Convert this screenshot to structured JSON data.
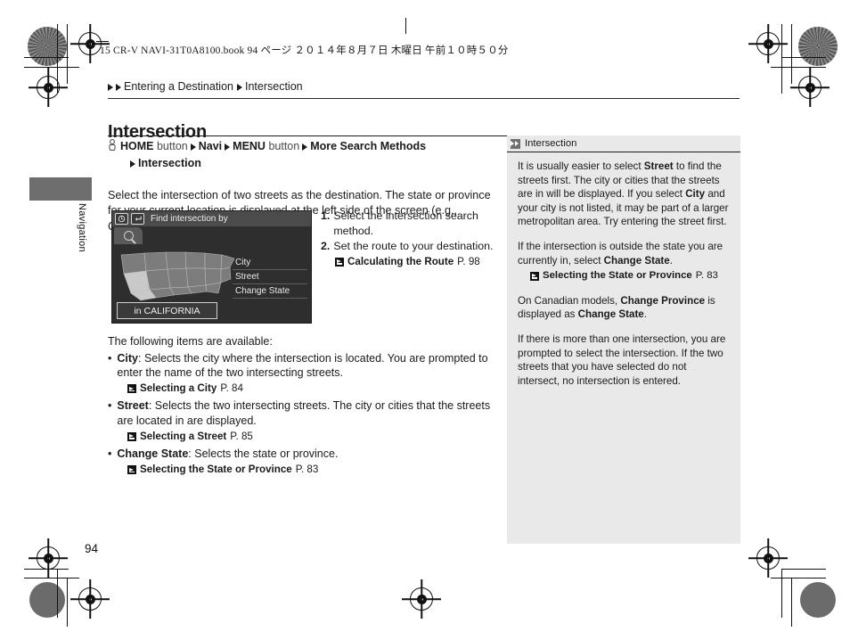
{
  "print_header": {
    "text": "15 CR-V NAVI-31T0A8100.book   94 ページ   ２０１４年８月７日   木曜日   午前１０時５０分"
  },
  "breadcrumb": {
    "item1": "Entering a Destination",
    "item2": "Intersection"
  },
  "side_tab": {
    "label": "Navigation"
  },
  "page": {
    "title": "Intersection",
    "folio": "94"
  },
  "navpath": {
    "hand_icon": "hand-pointer-icon",
    "home": "HOME",
    "home_suffix": "button",
    "navi": "Navi",
    "menu": "MENU",
    "menu_suffix": "button",
    "more_search": "More Search Methods",
    "intersection": "Intersection"
  },
  "intro": {
    "text": "Select the intersection of two streets as the destination. The state or province for your current location is displayed at the left side of the screen (e.g., CALIFORNIA)."
  },
  "device_screenshot": {
    "title": "Find intersection by",
    "title_icon_1": "clock-history-icon",
    "title_icon_2": "return-arrow-icon",
    "tab_icon": "search-magnifier-icon",
    "map_icon": "usa-map-image",
    "menu_items": [
      "City",
      "Street",
      "Change State"
    ],
    "state_label": "in CALIFORNIA"
  },
  "steps": [
    {
      "num": "1.",
      "text": "Select the intersection search method."
    },
    {
      "num": "2.",
      "text": "Set the route to your destination."
    }
  ],
  "steps_xref": {
    "icon": "jump-reference-icon",
    "label": "Calculating the Route",
    "page": "P. 98"
  },
  "list": {
    "lead": "The following items are available:",
    "bullet_char": "•",
    "items": [
      {
        "term": "City",
        "desc": ": Selects the city where the intersection is located. You are prompted to enter the name of the two intersecting streets.",
        "xref": {
          "icon": "jump-reference-icon",
          "label": "Selecting a City",
          "page": "P. 84"
        }
      },
      {
        "term": "Street",
        "desc": ": Selects the two intersecting streets. The city or cities that the streets are located in are displayed.",
        "xref": {
          "icon": "jump-reference-icon",
          "label": "Selecting a Street",
          "page": "P. 85"
        }
      },
      {
        "term": "Change State",
        "desc": ": Selects the state or province.",
        "xref": {
          "icon": "jump-reference-icon",
          "label": "Selecting the State or Province",
          "page": "P. 83"
        }
      }
    ]
  },
  "side_panel": {
    "header_icon": "double-chevron-icon",
    "header_title": "Intersection",
    "p1_a": "It is usually easier to select ",
    "p1_b": "Street",
    "p1_c": " to find the streets first. The city or cities that the streets are in will be displayed. If you select ",
    "p1_d": "City",
    "p1_e": " and your city is not listed, it may be part of a larger metropolitan area. Try entering the street first.",
    "p2_a": "If the intersection is outside the state you are currently in, select ",
    "p2_b": "Change State",
    "p2_c": ".",
    "xref": {
      "icon": "jump-reference-icon",
      "label": "Selecting the State or Province",
      "page": "P. 83"
    },
    "p3_a": "On Canadian models, ",
    "p3_b": "Change Province",
    "p3_c": " is displayed as ",
    "p3_d": "Change State",
    "p3_e": ".",
    "p4": "If there is more than one intersection, you are prompted to select the intersection. If the two streets that you have selected do not intersect, no intersection is entered."
  },
  "print_marks": {
    "registration": "registration-target-mark",
    "gauge": "halftone-dot-gauge",
    "trim": "trim-corner-mark"
  }
}
